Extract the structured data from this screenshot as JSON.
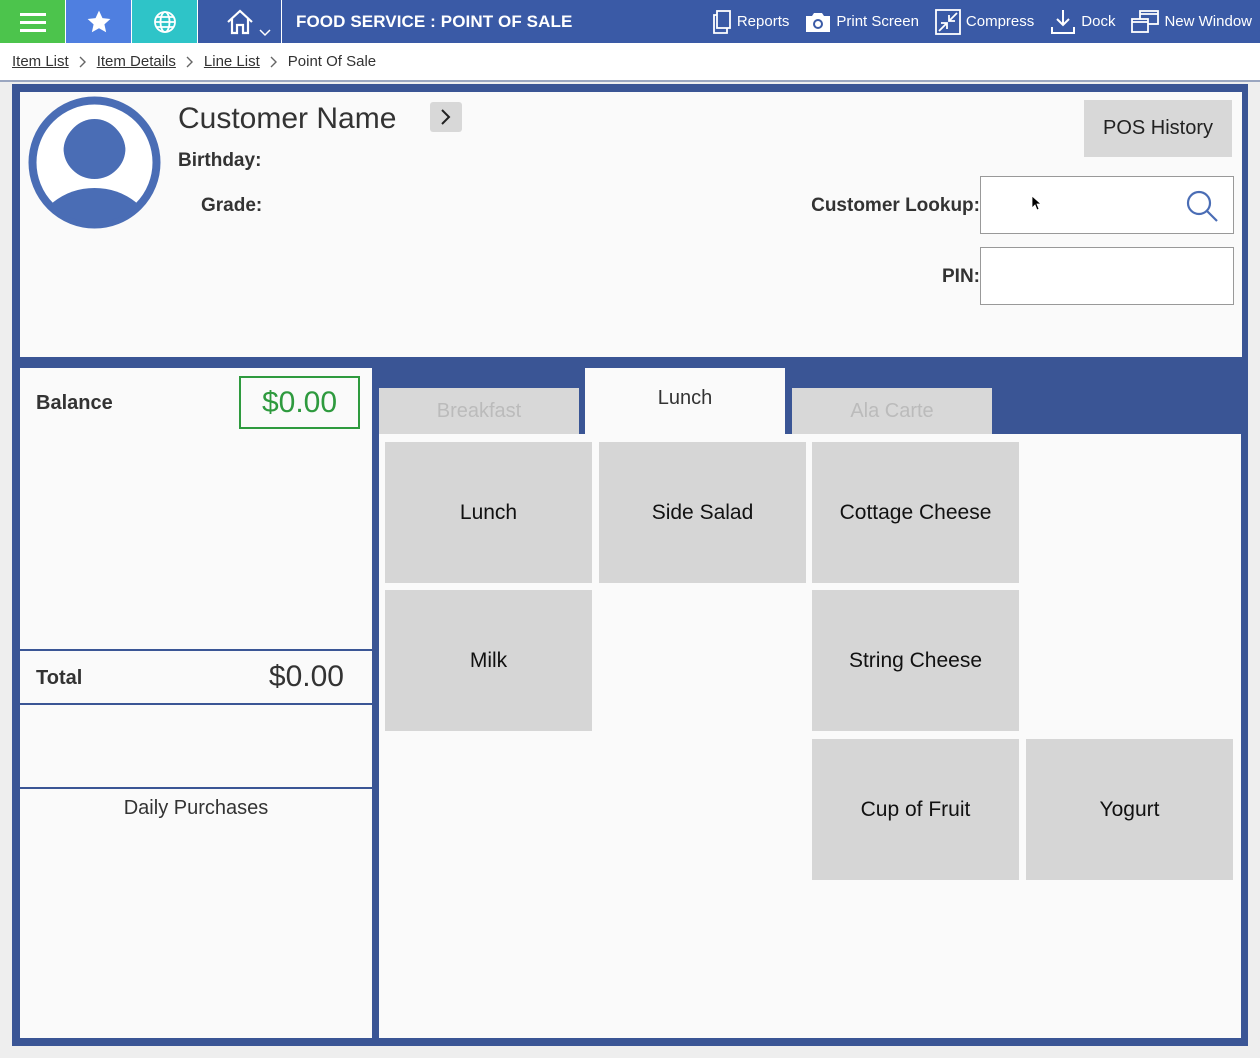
{
  "topbar": {
    "menu_icon": "hamburger-icon",
    "star_icon": "star-icon",
    "globe_icon": "globe-icon",
    "home_icon": "home-icon",
    "title": "FOOD SERVICE : POINT OF SALE",
    "actions": [
      {
        "label": "Reports",
        "icon": "reports-icon"
      },
      {
        "label": "Print Screen",
        "icon": "camera-icon"
      },
      {
        "label": "Compress",
        "icon": "compress-icon"
      },
      {
        "label": "Dock",
        "icon": "dock-icon"
      },
      {
        "label": "New Window",
        "icon": "new-window-icon"
      }
    ],
    "colors": {
      "bar": "#3a5aa6",
      "menu": "#4cc44c",
      "star": "#4f7fe0",
      "globe": "#2ec4c8"
    }
  },
  "breadcrumb": {
    "items": [
      "Item List",
      "Item Details",
      "Line List"
    ],
    "current": "Point Of Sale"
  },
  "customer": {
    "name": "Customer Name",
    "birthday_label": "Birthday:",
    "grade_label": "Grade:",
    "pos_history_label": "POS History",
    "lookup_label": "Customer Lookup:",
    "lookup_value": "",
    "pin_label": "PIN:",
    "pin_value": ""
  },
  "summary": {
    "balance_label": "Balance",
    "balance_value": "$0.00",
    "total_label": "Total",
    "total_value": "$0.00",
    "daily_purchases_label": "Daily Purchases",
    "balance_color": "#2e9a3e"
  },
  "tabs": [
    {
      "label": "Breakfast",
      "active": false
    },
    {
      "label": "Lunch",
      "active": true
    },
    {
      "label": "Ala Carte",
      "active": false
    }
  ],
  "items": [
    {
      "label": "Lunch"
    },
    {
      "label": "Side Salad"
    },
    {
      "label": "Cottage Cheese"
    },
    {
      "label": "Milk"
    },
    {
      "label": "String Cheese"
    },
    {
      "label": "Cup of Fruit"
    },
    {
      "label": "Yogurt"
    }
  ]
}
